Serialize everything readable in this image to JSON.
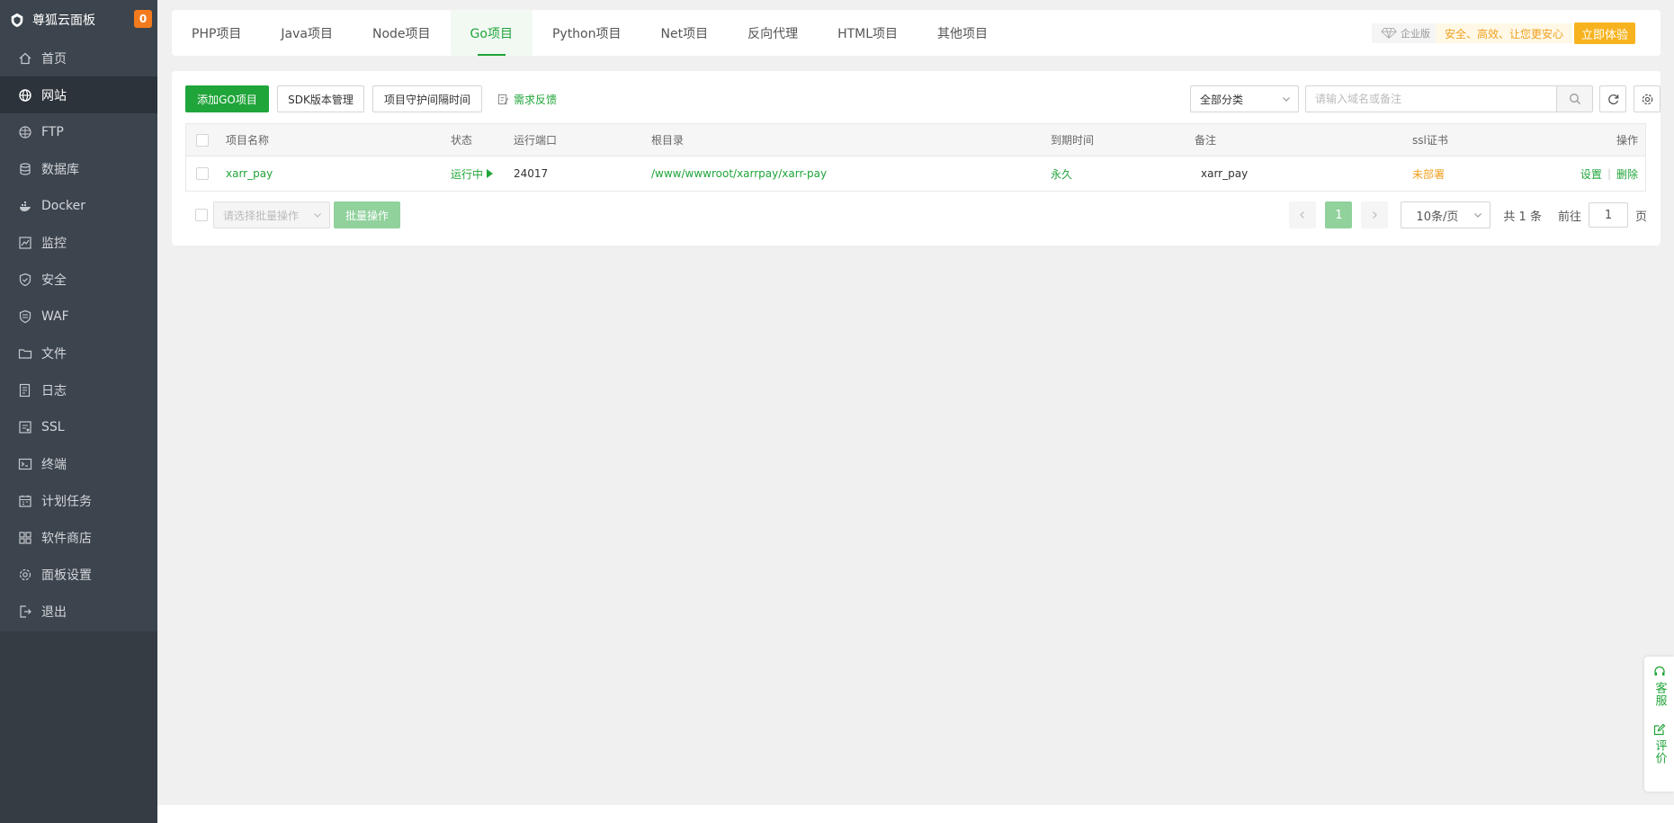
{
  "brand": {
    "name": "尊狐云面板",
    "badge": "0"
  },
  "sidebar": {
    "items": [
      {
        "label": "首页",
        "icon": "home-icon"
      },
      {
        "label": "网站",
        "icon": "globe-icon",
        "active": true
      },
      {
        "label": "FTP",
        "icon": "ftp-icon"
      },
      {
        "label": "数据库",
        "icon": "database-icon"
      },
      {
        "label": "Docker",
        "icon": "docker-icon"
      },
      {
        "label": "监控",
        "icon": "monitor-icon"
      },
      {
        "label": "安全",
        "icon": "shield-check-icon"
      },
      {
        "label": "WAF",
        "icon": "waf-shield-icon"
      },
      {
        "label": "文件",
        "icon": "folder-icon"
      },
      {
        "label": "日志",
        "icon": "log-icon"
      },
      {
        "label": "SSL",
        "icon": "ssl-icon"
      },
      {
        "label": "终端",
        "icon": "terminal-icon"
      },
      {
        "label": "计划任务",
        "icon": "calendar-icon"
      },
      {
        "label": "软件商店",
        "icon": "grid-icon"
      },
      {
        "label": "面板设置",
        "icon": "settings-icon"
      },
      {
        "label": "退出",
        "icon": "logout-icon"
      }
    ]
  },
  "tabs": [
    {
      "label": "PHP项目"
    },
    {
      "label": "Java项目"
    },
    {
      "label": "Node项目"
    },
    {
      "label": "Go项目",
      "active": true
    },
    {
      "label": "Python项目"
    },
    {
      "label": "Net项目"
    },
    {
      "label": "反向代理"
    },
    {
      "label": "HTML项目"
    },
    {
      "label": "其他项目"
    }
  ],
  "promo": {
    "edition": "企业版",
    "slogan": "安全、高效、让您更安心",
    "button": "立即体验"
  },
  "toolbar": {
    "add_label": "添加GO项目",
    "sdk_label": "SDK版本管理",
    "guard_label": "项目守护间隔时间",
    "feedback_label": "需求反馈",
    "category_value": "全部分类",
    "search_placeholder": "请输入域名或备注"
  },
  "table": {
    "headers": {
      "name": "项目名称",
      "status": "状态",
      "port": "运行端口",
      "root": "根目录",
      "expire": "到期时间",
      "remark": "备注",
      "ssl": "ssl证书",
      "ops": "操作"
    },
    "rows": [
      {
        "name": "xarr_pay",
        "status": "运行中",
        "port": "24017",
        "root": "/www/wwwroot/xarrpay/xarr-pay",
        "expire": "永久",
        "remark": "xarr_pay",
        "ssl": "未部署",
        "op_settings": "设置",
        "op_delete": "删除"
      }
    ]
  },
  "footer": {
    "batch_placeholder": "请选择批量操作",
    "batch_button": "批量操作",
    "current_page": "1",
    "per_page": "10条/页",
    "total": "共 1 条",
    "goto_label": "前往",
    "goto_value": "1",
    "page_unit": "页"
  },
  "float": {
    "service": "客服",
    "review": "评价"
  },
  "colors": {
    "brand_green": "#20a53a",
    "sidebar_bg": "#3c444d",
    "accent_orange": "#f0a020",
    "badge_orange": "#f37b1d"
  }
}
